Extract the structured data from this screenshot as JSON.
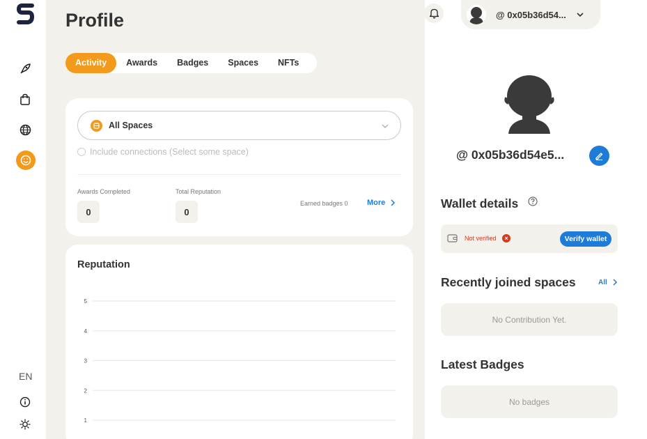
{
  "app": {
    "logo_letter": "S"
  },
  "sidebar": {
    "items": [
      {
        "name": "rocket-icon"
      },
      {
        "name": "shopping-bag-icon"
      },
      {
        "name": "globe-icon"
      },
      {
        "name": "profile-smile-icon"
      }
    ],
    "language": "EN"
  },
  "page": {
    "title": "Profile"
  },
  "tabs": [
    {
      "label": "Activity",
      "active": true
    },
    {
      "label": "Awards"
    },
    {
      "label": "Badges"
    },
    {
      "label": "Spaces"
    },
    {
      "label": "NFTs"
    }
  ],
  "filter": {
    "spaces_select": "All Spaces",
    "include_connections": "Include connections (Select some space)"
  },
  "stats": {
    "awards_completed_label": "Awards Completed",
    "awards_completed_value": "0",
    "total_reputation_label": "Total Reputation",
    "total_reputation_value": "0",
    "earned_badges": "Earned badges 0",
    "more_label": "More"
  },
  "reputation": {
    "title": "Reputation"
  },
  "chart_data": {
    "type": "line",
    "title": "",
    "xlabel": "",
    "ylabel": "",
    "yticks": [
      "5",
      "4",
      "3",
      "2",
      "1"
    ],
    "ylim": [
      1,
      5
    ],
    "series": [],
    "grid": true
  },
  "header": {
    "user_address_short": "@ 0x05b36d54..."
  },
  "profile": {
    "address": "@ 0x05b36d54e5..."
  },
  "wallet": {
    "title": "Wallet details",
    "status": "Not verified",
    "verify_label": "Verify wallet"
  },
  "recent_spaces": {
    "title": "Recently joined spaces",
    "all_label": "All",
    "empty_text": "No Contribution Yet."
  },
  "latest_badges": {
    "title": "Latest Badges",
    "empty_text": "No badges"
  },
  "colors": {
    "accent_orange": "#f39a1d",
    "link_blue": "#1f7bd8",
    "error_red": "#d9381e",
    "panel_beige": "#f3f1ec"
  }
}
